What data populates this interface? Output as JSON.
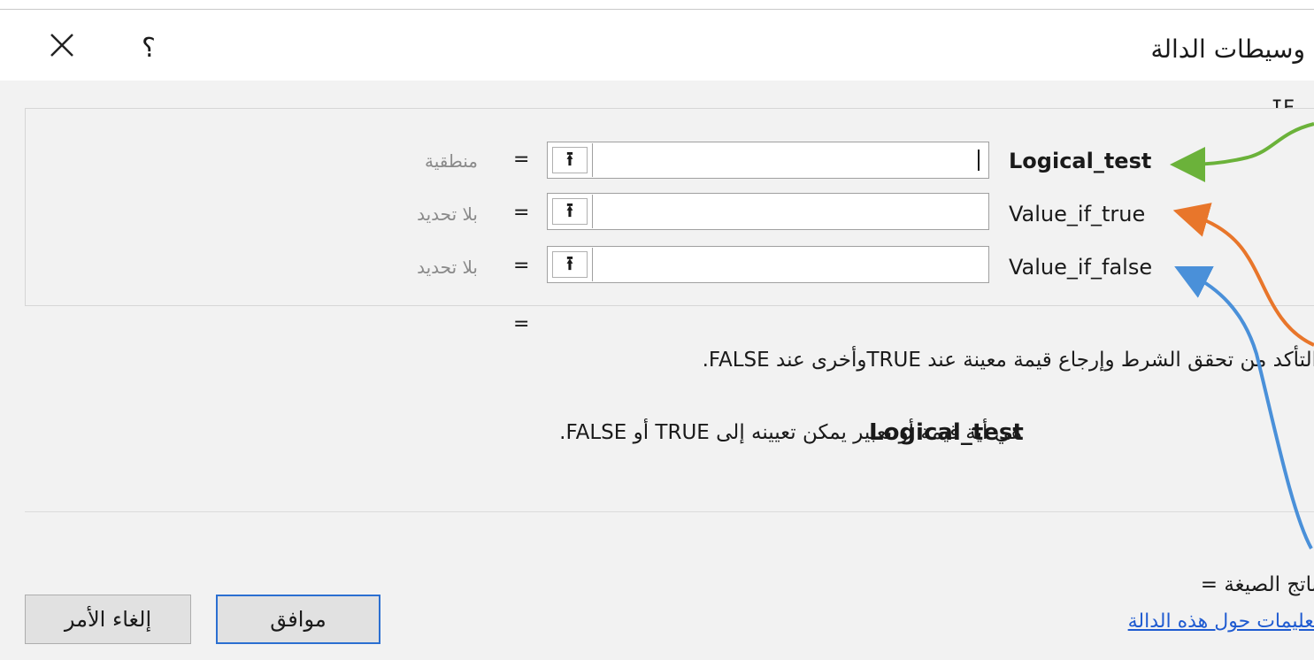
{
  "dialog": {
    "title": "وسيطات الدالة",
    "help_glyph": "؟",
    "close_glyph": "✕"
  },
  "function": {
    "name": "IF"
  },
  "arguments": [
    {
      "label": "Logical_test",
      "value": "منطقية",
      "equals": "=",
      "ref_glyph": "⭱",
      "focused": true
    },
    {
      "label": "Value_if_true",
      "value": "بلا تحديد",
      "equals": "=",
      "ref_glyph": "⭱",
      "focused": false
    },
    {
      "label": "Value_if_false",
      "value": "بلا تحديد",
      "equals": "=",
      "ref_glyph": "⭱",
      "focused": false
    }
  ],
  "result_equals": "=",
  "description": "التأكد من تحقق الشرط وإرجاع قيمة معينة عند TRUEوأخرى عند FALSE.",
  "argument_help": {
    "name": "Logical_test",
    "text": "هي أية قيمة أو تعبير يمكن تعيينه إلى TRUE أو FALSE."
  },
  "formula_result": "ناتج الصيغة =",
  "help_link": "تعليمات حول هذه الدالة",
  "buttons": {
    "ok": "موافق",
    "cancel": "إلغاء الأمر"
  },
  "annotation_colors": {
    "logical_test_arrow": "#6bb23a",
    "value_if_true_arrow": "#e8762b",
    "value_if_false_arrow": "#4a90d9"
  }
}
